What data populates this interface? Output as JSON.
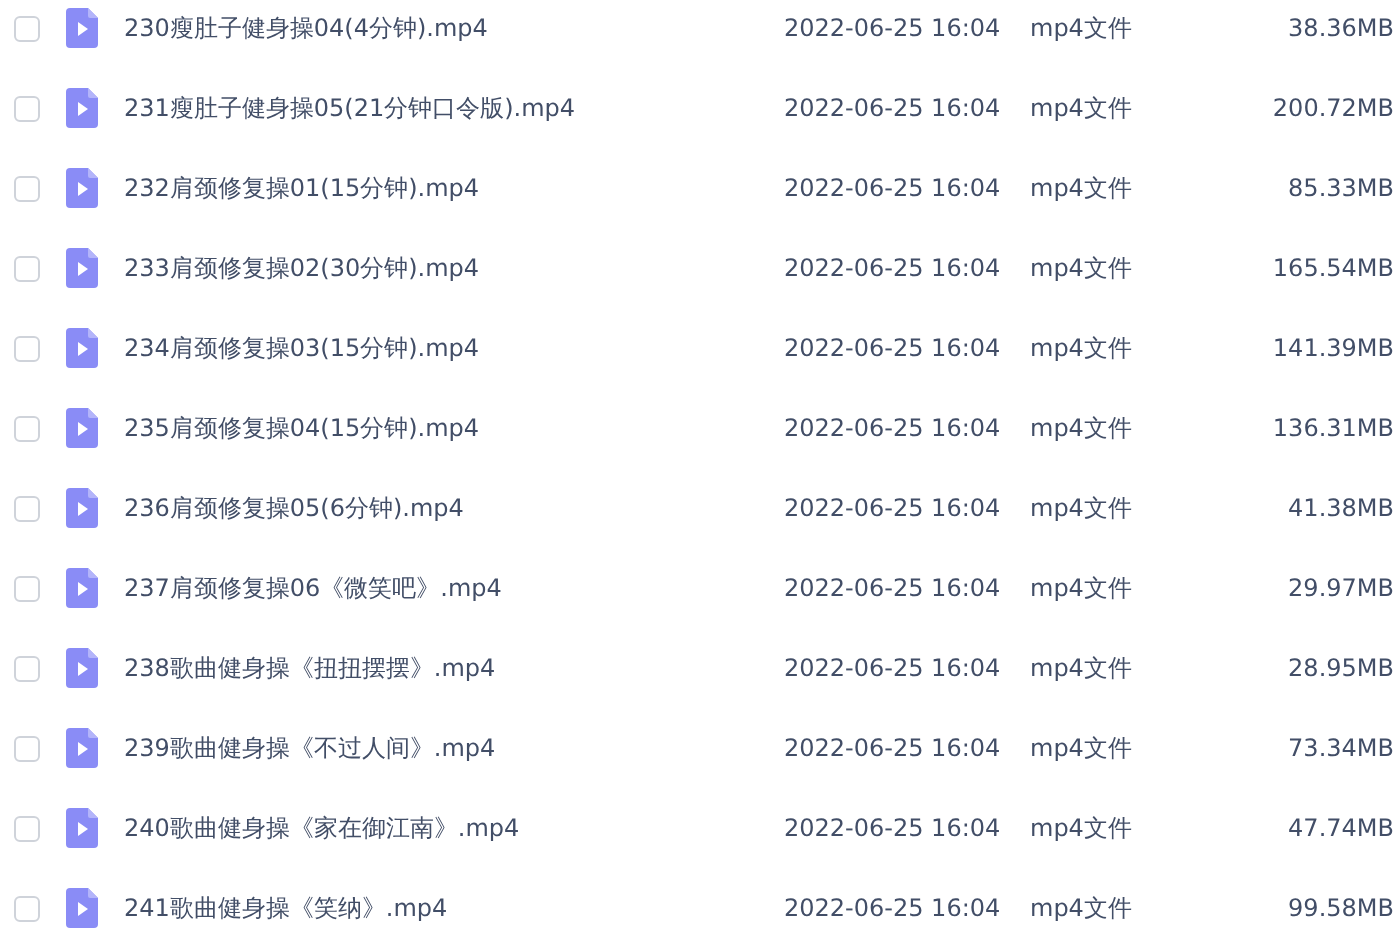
{
  "files": [
    {
      "name": "230瘦肚子健身操04(4分钟).mp4",
      "modified": "2022-06-25 16:04",
      "type": "mp4文件",
      "size": "38.36MB",
      "checked": false
    },
    {
      "name": "231瘦肚子健身操05(21分钟口令版).mp4",
      "modified": "2022-06-25 16:04",
      "type": "mp4文件",
      "size": "200.72MB",
      "checked": false
    },
    {
      "name": "232肩颈修复操01(15分钟).mp4",
      "modified": "2022-06-25 16:04",
      "type": "mp4文件",
      "size": "85.33MB",
      "checked": false
    },
    {
      "name": "233肩颈修复操02(30分钟).mp4",
      "modified": "2022-06-25 16:04",
      "type": "mp4文件",
      "size": "165.54MB",
      "checked": false
    },
    {
      "name": "234肩颈修复操03(15分钟).mp4",
      "modified": "2022-06-25 16:04",
      "type": "mp4文件",
      "size": "141.39MB",
      "checked": false
    },
    {
      "name": "235肩颈修复操04(15分钟).mp4",
      "modified": "2022-06-25 16:04",
      "type": "mp4文件",
      "size": "136.31MB",
      "checked": false
    },
    {
      "name": "236肩颈修复操05(6分钟).mp4",
      "modified": "2022-06-25 16:04",
      "type": "mp4文件",
      "size": "41.38MB",
      "checked": false
    },
    {
      "name": "237肩颈修复操06《微笑吧》.mp4",
      "modified": "2022-06-25 16:04",
      "type": "mp4文件",
      "size": "29.97MB",
      "checked": false
    },
    {
      "name": "238歌曲健身操《扭扭摆摆》.mp4",
      "modified": "2022-06-25 16:04",
      "type": "mp4文件",
      "size": "28.95MB",
      "checked": false
    },
    {
      "name": "239歌曲健身操《不过人间》.mp4",
      "modified": "2022-06-25 16:04",
      "type": "mp4文件",
      "size": "73.34MB",
      "checked": false
    },
    {
      "name": "240歌曲健身操《家在御江南》.mp4",
      "modified": "2022-06-25 16:04",
      "type": "mp4文件",
      "size": "47.74MB",
      "checked": false
    },
    {
      "name": "241歌曲健身操《笑纳》.mp4",
      "modified": "2022-06-25 16:04",
      "type": "mp4文件",
      "size": "99.58MB",
      "checked": false
    }
  ]
}
